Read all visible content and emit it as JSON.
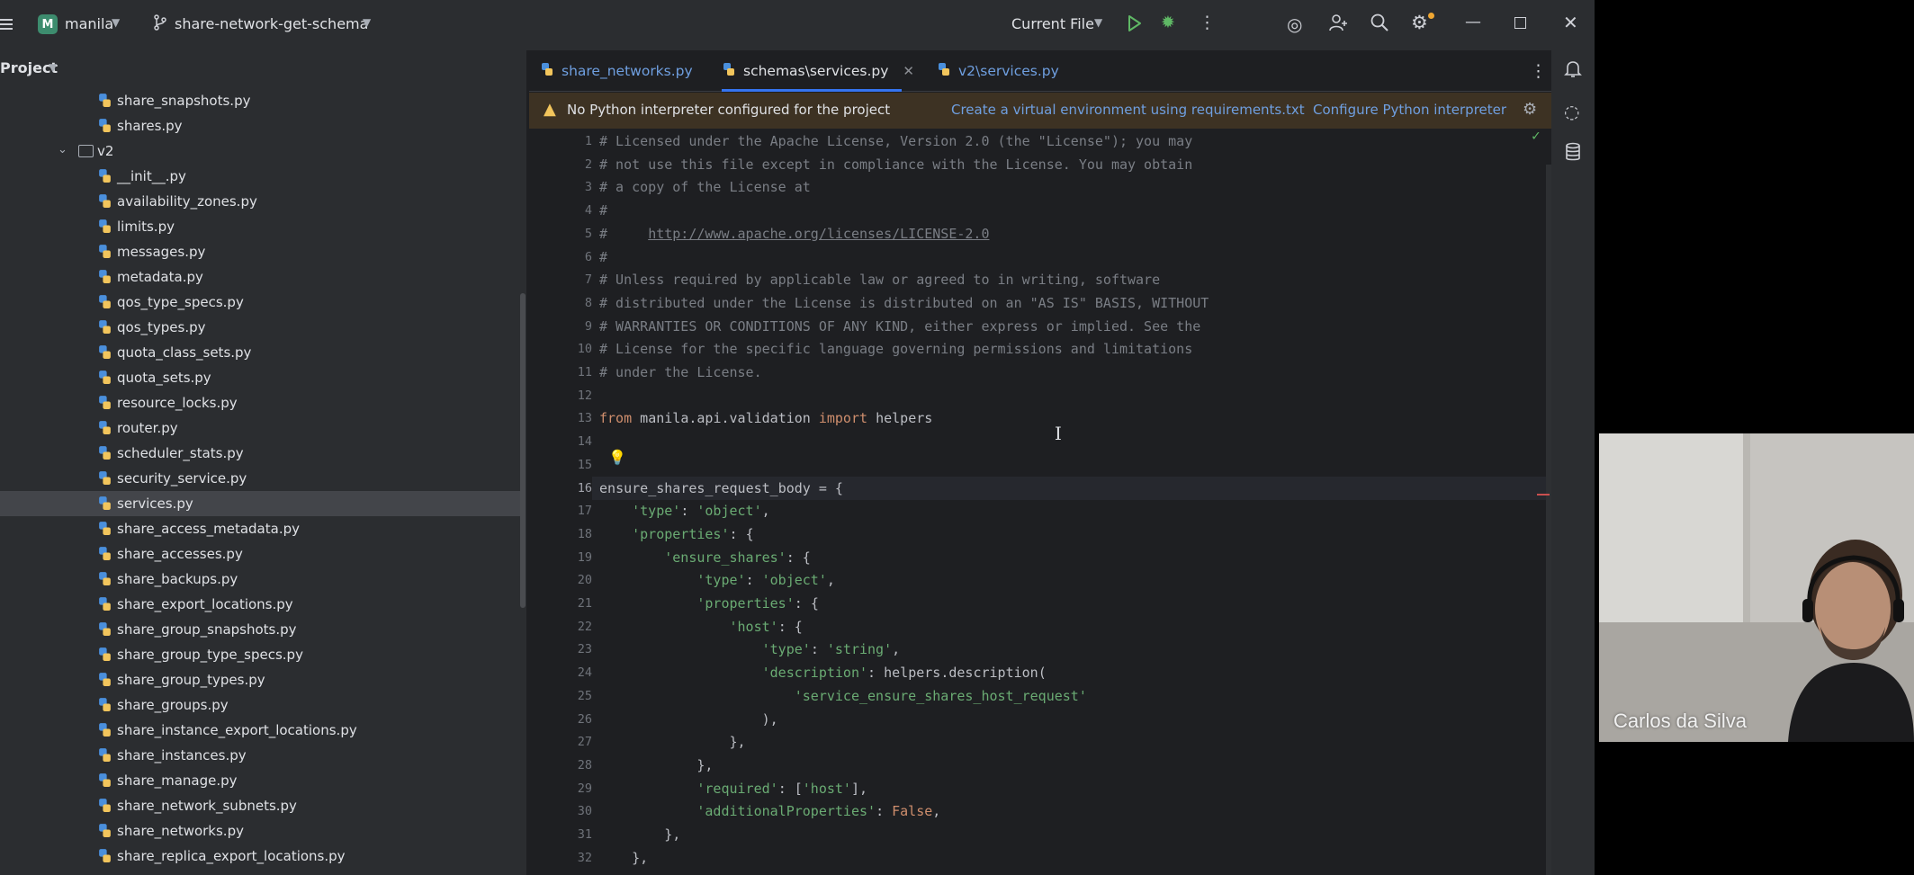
{
  "titlebar": {
    "project_initial": "M",
    "project_name": "manila",
    "branch_name": "share-network-get-schema",
    "run_config": "Current File"
  },
  "project_panel": {
    "title": "Project",
    "items": [
      {
        "label": "share_snapshots.py",
        "type": "file"
      },
      {
        "label": "shares.py",
        "type": "file"
      },
      {
        "label": "v2",
        "type": "folder"
      },
      {
        "label": "__init__.py",
        "type": "file"
      },
      {
        "label": "availability_zones.py",
        "type": "file"
      },
      {
        "label": "limits.py",
        "type": "file"
      },
      {
        "label": "messages.py",
        "type": "file"
      },
      {
        "label": "metadata.py",
        "type": "file"
      },
      {
        "label": "qos_type_specs.py",
        "type": "file"
      },
      {
        "label": "qos_types.py",
        "type": "file"
      },
      {
        "label": "quota_class_sets.py",
        "type": "file"
      },
      {
        "label": "quota_sets.py",
        "type": "file"
      },
      {
        "label": "resource_locks.py",
        "type": "file"
      },
      {
        "label": "router.py",
        "type": "file"
      },
      {
        "label": "scheduler_stats.py",
        "type": "file"
      },
      {
        "label": "security_service.py",
        "type": "file"
      },
      {
        "label": "services.py",
        "type": "file",
        "selected": true
      },
      {
        "label": "share_access_metadata.py",
        "type": "file"
      },
      {
        "label": "share_accesses.py",
        "type": "file"
      },
      {
        "label": "share_backups.py",
        "type": "file"
      },
      {
        "label": "share_export_locations.py",
        "type": "file"
      },
      {
        "label": "share_group_snapshots.py",
        "type": "file"
      },
      {
        "label": "share_group_type_specs.py",
        "type": "file"
      },
      {
        "label": "share_group_types.py",
        "type": "file"
      },
      {
        "label": "share_groups.py",
        "type": "file"
      },
      {
        "label": "share_instance_export_locations.py",
        "type": "file"
      },
      {
        "label": "share_instances.py",
        "type": "file"
      },
      {
        "label": "share_manage.py",
        "type": "file"
      },
      {
        "label": "share_network_subnets.py",
        "type": "file"
      },
      {
        "label": "share_networks.py",
        "type": "file"
      },
      {
        "label": "share_replica_export_locations.py",
        "type": "file"
      }
    ]
  },
  "tabs": [
    {
      "label": "share_networks.py",
      "active": false
    },
    {
      "label": "schemas\\services.py",
      "active": true
    },
    {
      "label": "v2\\services.py",
      "active": false
    }
  ],
  "banner": {
    "message": "No Python interpreter configured for the project",
    "link_venv": "Create a virtual environment using requirements.txt",
    "link_configure": "Configure Python interpreter"
  },
  "editor": {
    "current_line": 16,
    "lines": [
      {
        "n": "1",
        "code": "# Licensed under the Apache License, Version 2.0 (the \"License\"); you may"
      },
      {
        "n": "2",
        "code": "# not use this file except in compliance with the License. You may obtain"
      },
      {
        "n": "3",
        "code": "# a copy of the License at"
      },
      {
        "n": "4",
        "code": "#"
      },
      {
        "n": "5",
        "code": "#     http://www.apache.org/licenses/LICENSE-2.0"
      },
      {
        "n": "6",
        "code": "#"
      },
      {
        "n": "7",
        "code": "# Unless required by applicable law or agreed to in writing, software"
      },
      {
        "n": "8",
        "code": "# distributed under the License is distributed on an \"AS IS\" BASIS, WITHOUT"
      },
      {
        "n": "9",
        "code": "# WARRANTIES OR CONDITIONS OF ANY KIND, either express or implied. See the"
      },
      {
        "n": "10",
        "code": "# License for the specific language governing permissions and limitations"
      },
      {
        "n": "11",
        "code": "# under the License."
      },
      {
        "n": "12",
        "code": ""
      },
      {
        "n": "13",
        "code": "from manila.api.validation import helpers"
      },
      {
        "n": "14",
        "code": ""
      },
      {
        "n": "15",
        "code": ""
      },
      {
        "n": "16",
        "code": "ensure_shares_request_body = {"
      },
      {
        "n": "17",
        "code": "    'type': 'object',"
      },
      {
        "n": "18",
        "code": "    'properties': {"
      },
      {
        "n": "19",
        "code": "        'ensure_shares': {"
      },
      {
        "n": "20",
        "code": "            'type': 'object',"
      },
      {
        "n": "21",
        "code": "            'properties': {"
      },
      {
        "n": "22",
        "code": "                'host': {"
      },
      {
        "n": "23",
        "code": "                    'type': 'string',"
      },
      {
        "n": "24",
        "code": "                    'description': helpers.description("
      },
      {
        "n": "25",
        "code": "                        'service_ensure_shares_host_request'"
      },
      {
        "n": "26",
        "code": "                    ),"
      },
      {
        "n": "27",
        "code": "                },"
      },
      {
        "n": "28",
        "code": "            },"
      },
      {
        "n": "29",
        "code": "            'required': ['host'],"
      },
      {
        "n": "30",
        "code": "            'additionalProperties': False,"
      },
      {
        "n": "31",
        "code": "        },"
      },
      {
        "n": "32",
        "code": "    },"
      }
    ]
  },
  "webcam": {
    "participant_name": "Carlos da Silva"
  },
  "colors": {
    "accent": "#3574f0",
    "link": "#6f9fe0",
    "warning": "#f2c55c",
    "string": "#6aab73",
    "keyword": "#cf8e6d",
    "comment": "#7a7e85"
  },
  "icons": {
    "menu": "hamburger-icon",
    "branch": "git-branch-icon",
    "run": "play-icon",
    "debug": "bug-icon",
    "search": "search-icon",
    "settings": "gear-icon",
    "python_file": "python-file-icon",
    "folder": "folder-icon",
    "warning": "warning-icon"
  }
}
